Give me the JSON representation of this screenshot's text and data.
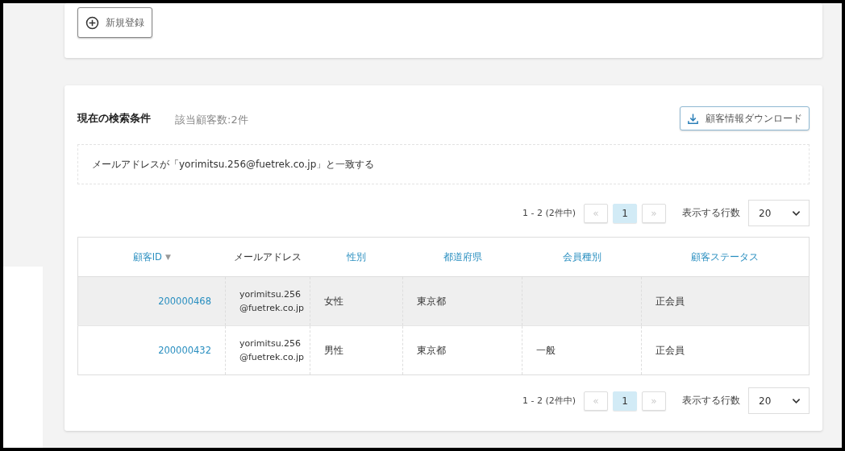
{
  "new_button": {
    "label": "新規登録"
  },
  "search_conditions": {
    "title": "現在の検索条件",
    "count": "該当顧客数:2件",
    "download_button": "顧客情報ダウンロード",
    "condition": "メールアドレスが「yorimitsu.256@fuetrek.co.jp」と一致する"
  },
  "pagination_top": {
    "range": "1 - 2 (2件中)",
    "prev": {
      "label": "«",
      "disabled": true
    },
    "pages": [
      {
        "label": "1",
        "selected": true
      }
    ],
    "next": {
      "label": "»",
      "disabled": true
    },
    "rows_label": "表示する行数",
    "rows_value": "20"
  },
  "table": {
    "columns": [
      {
        "label": "顧客ID",
        "sortable": true,
        "sort_mark": "▼"
      },
      {
        "label": "メールアドレス",
        "sortable": false
      },
      {
        "label": "性別",
        "sortable": true
      },
      {
        "label": "都道府県",
        "sortable": true
      },
      {
        "label": "会員種別",
        "sortable": true
      },
      {
        "label": "顧客ステータス",
        "sortable": true
      }
    ],
    "rows": [
      {
        "highlighted": true,
        "id": "200000468",
        "email": "yorimitsu.256@fuetrek.co.jp",
        "gender": "女性",
        "prefecture": "東京都",
        "member_type": "",
        "status": "正会員"
      },
      {
        "highlighted": false,
        "id": "200000432",
        "email": "yorimitsu.256@fuetrek.co.jp",
        "gender": "男性",
        "prefecture": "東京都",
        "member_type": "一般",
        "status": "正会員"
      }
    ]
  },
  "pagination_bottom": {
    "range": "1 - 2 (2件中)",
    "prev": {
      "label": "«",
      "disabled": true
    },
    "pages": [
      {
        "label": "1",
        "selected": true
      }
    ],
    "next": {
      "label": "»",
      "disabled": true
    },
    "rows_label": "表示する行数",
    "rows_value": "20"
  }
}
